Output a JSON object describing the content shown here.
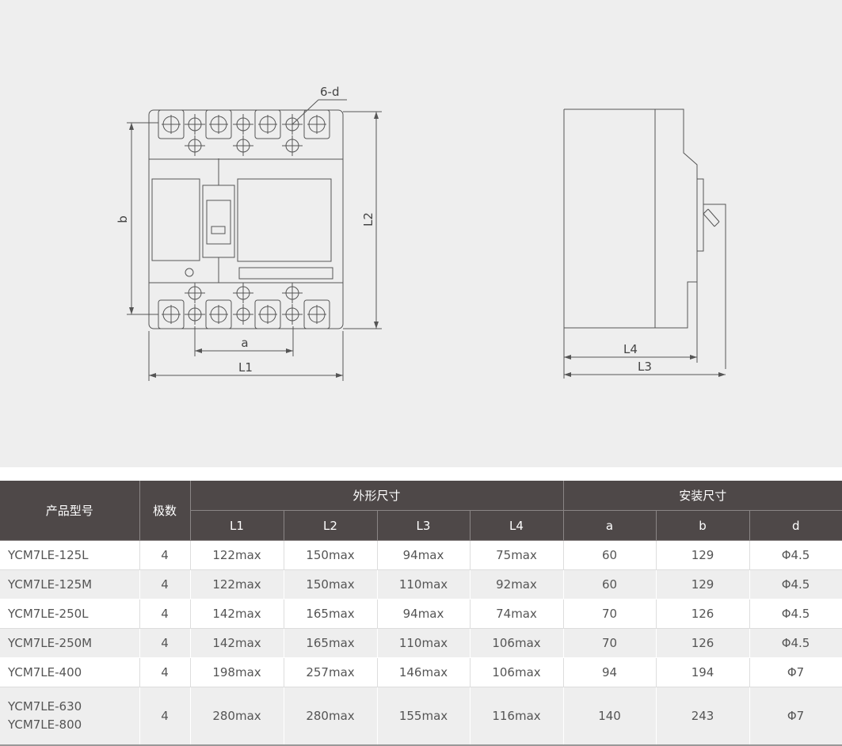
{
  "drawing": {
    "front_labels": {
      "holes": "6-d",
      "b": "b",
      "L2": "L2",
      "a": "a",
      "L1": "L1"
    },
    "side_labels": {
      "L4": "L4",
      "L3": "L3"
    }
  },
  "table": {
    "group_headers": {
      "model": "产品型号",
      "poles": "极数",
      "outer": "外形尺寸",
      "mount": "安装尺寸"
    },
    "sub_headers": [
      "L1",
      "L2",
      "L3",
      "L4",
      "a",
      "b",
      "d"
    ],
    "rows": [
      {
        "model": "YCM7LE-125L",
        "poles": "4",
        "L1": "122max",
        "L2": "150max",
        "L3": "94max",
        "L4": "75max",
        "a": "60",
        "b": "129",
        "d": "Φ4.5"
      },
      {
        "model": "YCM7LE-125M",
        "poles": "4",
        "L1": "122max",
        "L2": "150max",
        "L3": "110max",
        "L4": "92max",
        "a": "60",
        "b": "129",
        "d": "Φ4.5"
      },
      {
        "model": "YCM7LE-250L",
        "poles": "4",
        "L1": "142max",
        "L2": "165max",
        "L3": "94max",
        "L4": "74max",
        "a": "70",
        "b": "126",
        "d": "Φ4.5"
      },
      {
        "model": "YCM7LE-250M",
        "poles": "4",
        "L1": "142max",
        "L2": "165max",
        "L3": "110max",
        "L4": "106max",
        "a": "70",
        "b": "126",
        "d": "Φ4.5"
      },
      {
        "model": "YCM7LE-400",
        "poles": "4",
        "L1": "198max",
        "L2": "257max",
        "L3": "146max",
        "L4": "106max",
        "a": "94",
        "b": "194",
        "d": "Φ7"
      },
      {
        "model": "YCM7LE-630",
        "model2": "YCM7LE-800",
        "poles": "4",
        "L1": "280max",
        "L2": "280max",
        "L3": "155max",
        "L4": "116max",
        "a": "140",
        "b": "243",
        "d": "Φ7"
      }
    ]
  }
}
